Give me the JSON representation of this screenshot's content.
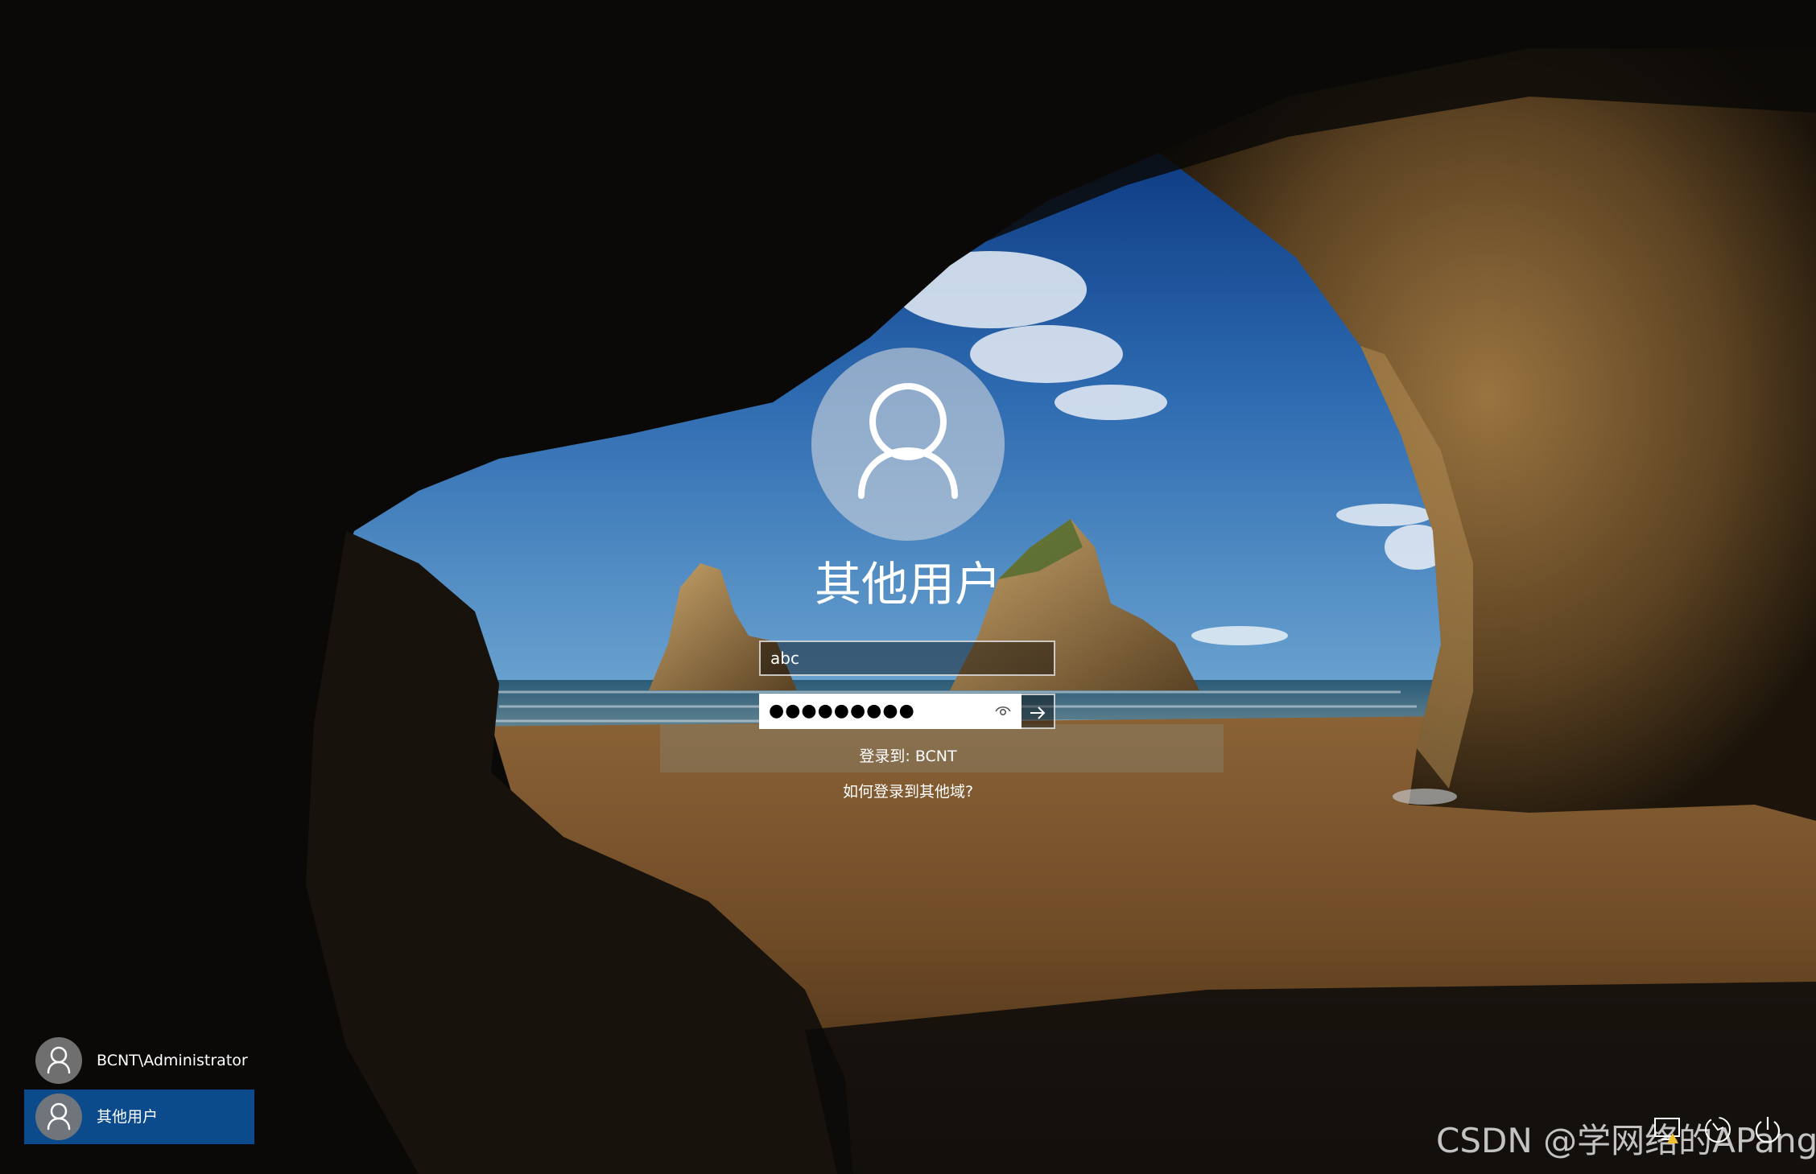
{
  "signin": {
    "title": "其他用户",
    "username_value": "abc",
    "password_mask": "●●●●●●●●●",
    "signin_to": "登录到: BCNT",
    "other_domain_link": "如何登录到其他域?"
  },
  "user_list": [
    {
      "label": "BCNT\\Administrator",
      "selected": false
    },
    {
      "label": "其他用户",
      "selected": true
    }
  ],
  "system_icons": [
    "network-icon",
    "ease-of-access-icon",
    "power-icon"
  ],
  "watermark": "CSDN @学网络的APang",
  "colors": {
    "selected_user_bg": "#0b4a8b",
    "text": "#ffffff"
  }
}
